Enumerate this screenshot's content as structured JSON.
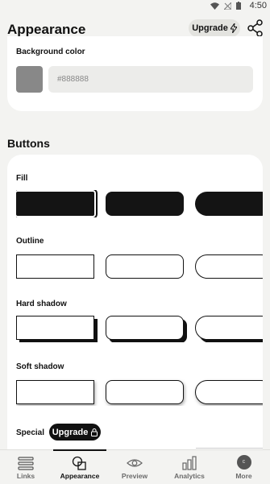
{
  "status_bar": {
    "time": "4:50"
  },
  "header": {
    "title": "Appearance",
    "upgrade_label": "Upgrade"
  },
  "background": {
    "label": "Background color",
    "input_value": "#888888",
    "swatch_color": "#888888"
  },
  "buttons": {
    "section_title": "Buttons",
    "groups": [
      {
        "label": "Fill"
      },
      {
        "label": "Outline"
      },
      {
        "label": "Hard shadow"
      },
      {
        "label": "Soft shadow"
      }
    ],
    "special": {
      "label": "Special",
      "upgrade_label": "Upgrade"
    }
  },
  "nav": {
    "items": [
      {
        "label": "Links",
        "icon": "links-icon"
      },
      {
        "label": "Appearance",
        "icon": "appearance-icon",
        "active": true
      },
      {
        "label": "Preview",
        "icon": "eye-icon"
      },
      {
        "label": "Analytics",
        "icon": "bar-chart-icon"
      },
      {
        "label": "More",
        "icon": "avatar",
        "avatar_letter": "c"
      }
    ]
  },
  "colors": {
    "accent": "#111111",
    "surface": "#ffffff",
    "background": "#f3f3f1"
  }
}
